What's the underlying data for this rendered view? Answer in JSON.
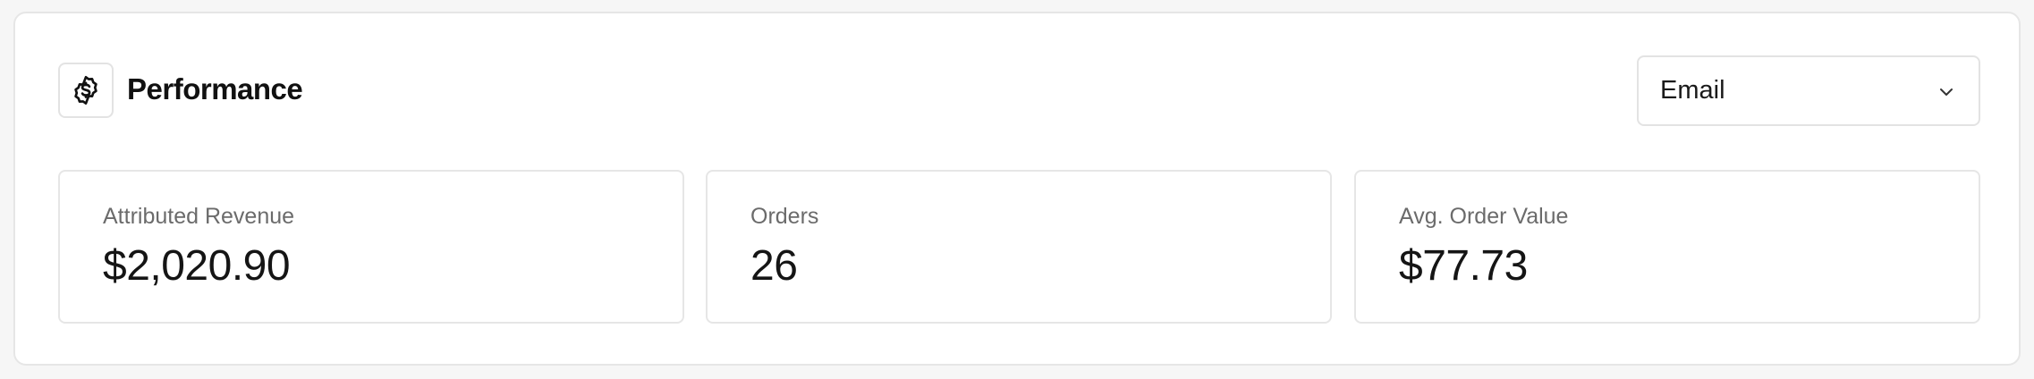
{
  "header": {
    "title": "Performance",
    "icon": "dollar-badge-icon"
  },
  "channel_select": {
    "selected": "Email"
  },
  "stats": [
    {
      "label": "Attributed Revenue",
      "value": "$2,020.90"
    },
    {
      "label": "Orders",
      "value": "26"
    },
    {
      "label": "Avg. Order Value",
      "value": "$77.73"
    }
  ]
}
